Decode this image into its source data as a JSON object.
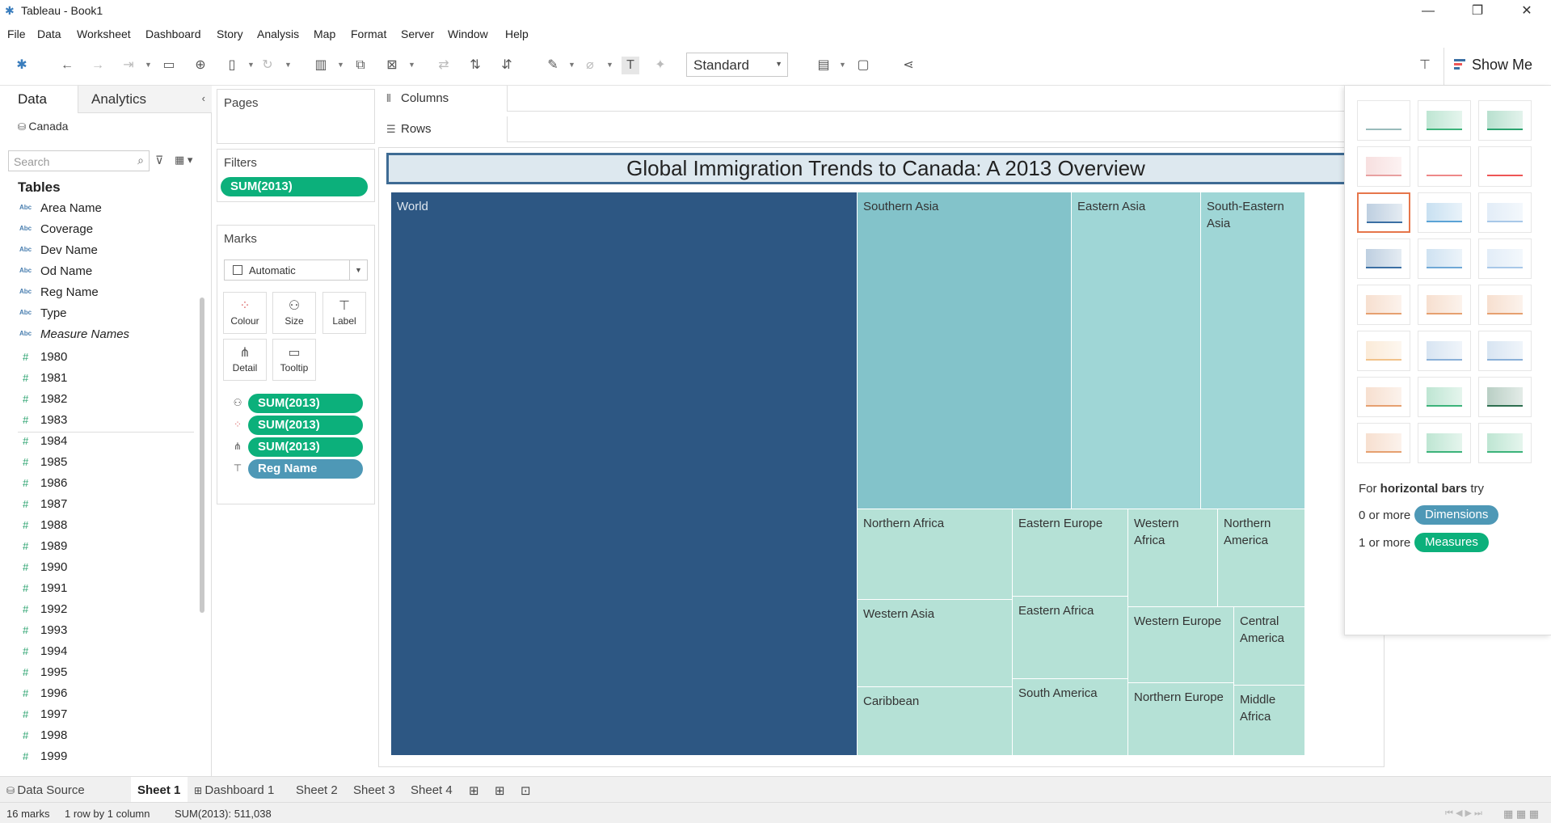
{
  "app": {
    "title": "Tableau - Book1"
  },
  "menu": [
    "File",
    "Data",
    "Worksheet",
    "Dashboard",
    "Story",
    "Analysis",
    "Map",
    "Format",
    "Server",
    "Window",
    "Help"
  ],
  "toolbar": {
    "fit_mode": "Standard",
    "show_me_label": "Show Me"
  },
  "data_pane": {
    "tab_data": "Data",
    "tab_analytics": "Analytics",
    "datasource": "Canada",
    "search_placeholder": "Search",
    "tables_heading": "Tables",
    "dimensions": [
      {
        "type": "Abc",
        "name": "Area Name"
      },
      {
        "type": "Abc",
        "name": "Coverage"
      },
      {
        "type": "Abc",
        "name": "Dev Name"
      },
      {
        "type": "Abc",
        "name": "Od Name"
      },
      {
        "type": "Abc",
        "name": "Reg Name"
      },
      {
        "type": "Abc",
        "name": "Type"
      },
      {
        "type": "Abc",
        "name": "Measure Names"
      }
    ],
    "measures": [
      "1980",
      "1981",
      "1982",
      "1983",
      "1984",
      "1985",
      "1986",
      "1987",
      "1988",
      "1989",
      "1990",
      "1991",
      "1992",
      "1993",
      "1994",
      "1995",
      "1996",
      "1997",
      "1998",
      "1999"
    ]
  },
  "shelves": {
    "pages": "Pages",
    "filters": "Filters",
    "filter_pill": "SUM(2013)",
    "marks": "Marks",
    "mark_type": "Automatic",
    "mark_buttons": [
      "Colour",
      "Size",
      "Label",
      "Detail",
      "Tooltip"
    ],
    "mark_pills": [
      {
        "label": "SUM(2013)",
        "kind": "size"
      },
      {
        "label": "SUM(2013)",
        "kind": "colour"
      },
      {
        "label": "SUM(2013)",
        "kind": "detail"
      },
      {
        "label": "Reg Name",
        "kind": "label"
      }
    ],
    "columns": "Columns",
    "rows": "Rows"
  },
  "view": {
    "title": "Global Immigration Trends to Canada: A 2013 Overview"
  },
  "treemap": {
    "colors": {
      "dark": "#2d5783",
      "mid": "#83c3ca",
      "light": "#9fd6d6",
      "pale": "#b5e1d6"
    },
    "cells": [
      "World",
      "Southern Asia",
      "Eastern Asia",
      "South-Eastern Asia",
      "Northern Africa",
      "Eastern Europe",
      "Western Africa",
      "Northern America",
      "Western Asia",
      "Eastern Africa",
      "Western Europe",
      "Central America",
      "Caribbean",
      "South America",
      "Northern Europe",
      "Middle Africa"
    ]
  },
  "show_me": {
    "hint_prefix": "For",
    "hint_bold": "horizontal bars",
    "hint_suffix": "try",
    "line1_prefix": "0 or more",
    "line1_pill": "Dimensions",
    "line2_prefix": "1 or more",
    "line2_pill": "Measures",
    "dim_color": "#4e98b6",
    "meas_color": "#0cb07b"
  },
  "sheet_tabs": {
    "data_source": "Data Source",
    "tabs": [
      "Sheet 1",
      "Dashboard 1",
      "Sheet 2",
      "Sheet 3",
      "Sheet 4"
    ]
  },
  "status": {
    "marks": "16 marks",
    "grid": "1 row  by  1 column",
    "sum": "SUM(2013): 511,038"
  }
}
